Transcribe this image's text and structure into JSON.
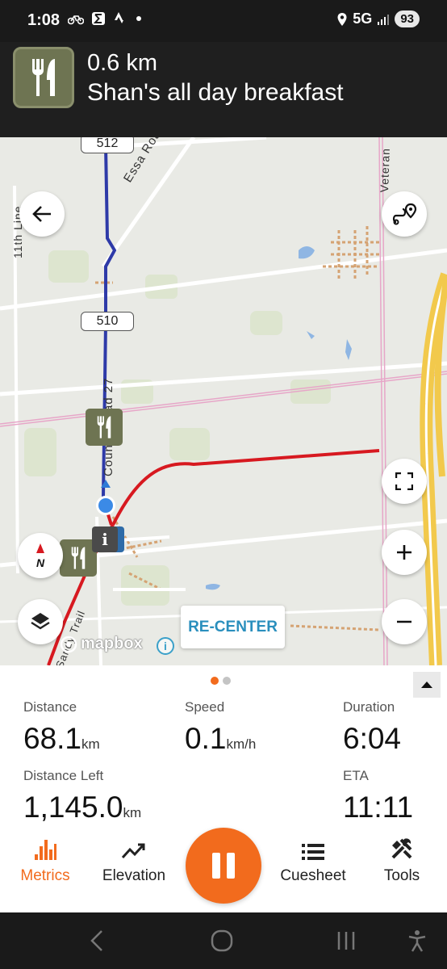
{
  "status_bar": {
    "time": "1:08",
    "network": "5G",
    "battery": "93"
  },
  "navigation": {
    "distance": "0.6 km",
    "poi_name": "Shan's all day breakfast",
    "poi_icon": "fork-knife-icon"
  },
  "map": {
    "road_labels": {
      "essa_road": "Essa Road",
      "county_road": "County Road 27",
      "eleventh_line": "11th Line",
      "veteran": "Veteran",
      "trail": "Sandy Trail"
    },
    "shields": {
      "top": "512",
      "middle": "510"
    },
    "recenter_label": "RE-CENTER",
    "attribution": "mapbox",
    "colors": {
      "route_blue": "#2e3aa8",
      "route_red": "#d71920",
      "highway_yellow": "#f2c94c",
      "accent_orange": "#f26b1d"
    }
  },
  "metrics": {
    "distance": {
      "label": "Distance",
      "value": "68.1",
      "unit": "km"
    },
    "speed": {
      "label": "Speed",
      "value": "0.1",
      "unit": "km/h"
    },
    "duration": {
      "label": "Duration",
      "value": "6:04"
    },
    "distance_left": {
      "label": "Distance Left",
      "value": "1,145.0",
      "unit": "km"
    },
    "eta": {
      "label": "ETA",
      "value": "11:11"
    }
  },
  "tabs": [
    {
      "label": "Metrics",
      "icon": "bar-chart-icon",
      "active": true
    },
    {
      "label": "Elevation",
      "icon": "trend-line-icon",
      "active": false
    },
    {
      "label": "Cuesheet",
      "icon": "list-icon",
      "active": false
    },
    {
      "label": "Tools",
      "icon": "tools-icon",
      "active": false
    }
  ],
  "pause_icon": "pause-icon"
}
